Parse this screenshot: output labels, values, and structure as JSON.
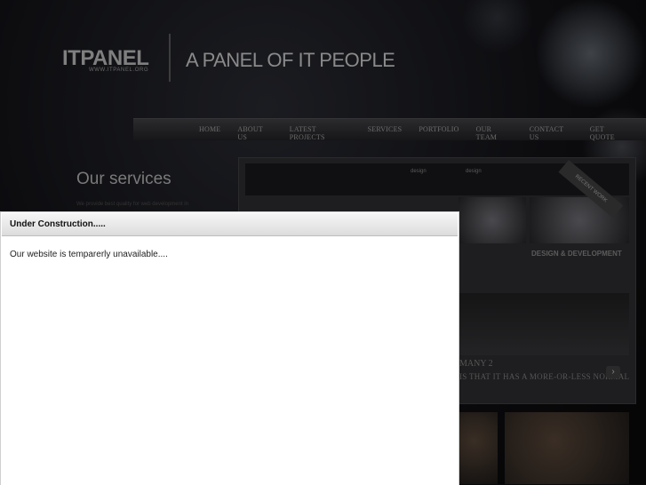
{
  "header": {
    "logo": "ITPANEL",
    "logo_url": "WWW.ITPANEL.ORG",
    "tagline": "A PANEL OF IT PEOPLE"
  },
  "nav": {
    "items": [
      "HOME",
      "ABOUT US",
      "LATEST PROJECTS",
      "SERVICES",
      "PORTFOLIO",
      "OUR TEAM",
      "CONTACT US",
      "GET QUOTE"
    ]
  },
  "main": {
    "services_title": "Our services",
    "services_intro": "We provide best quality for web development in"
  },
  "panel": {
    "chip_1": "design",
    "chip_2": "design",
    "ribbon": "RECENT WORK",
    "design_dev": "DESIGN & DEVELOPMENT",
    "company": "MANY 2",
    "company_sub": "IS THAT IT HAS A MORE-OR-LESS NORMAL"
  },
  "dialog": {
    "title": "Under Construction.....",
    "message": "Our website is temparerly unavailable...."
  },
  "colors": {
    "background": "#0a0a0c",
    "dialog_bg": "#ffffff"
  }
}
